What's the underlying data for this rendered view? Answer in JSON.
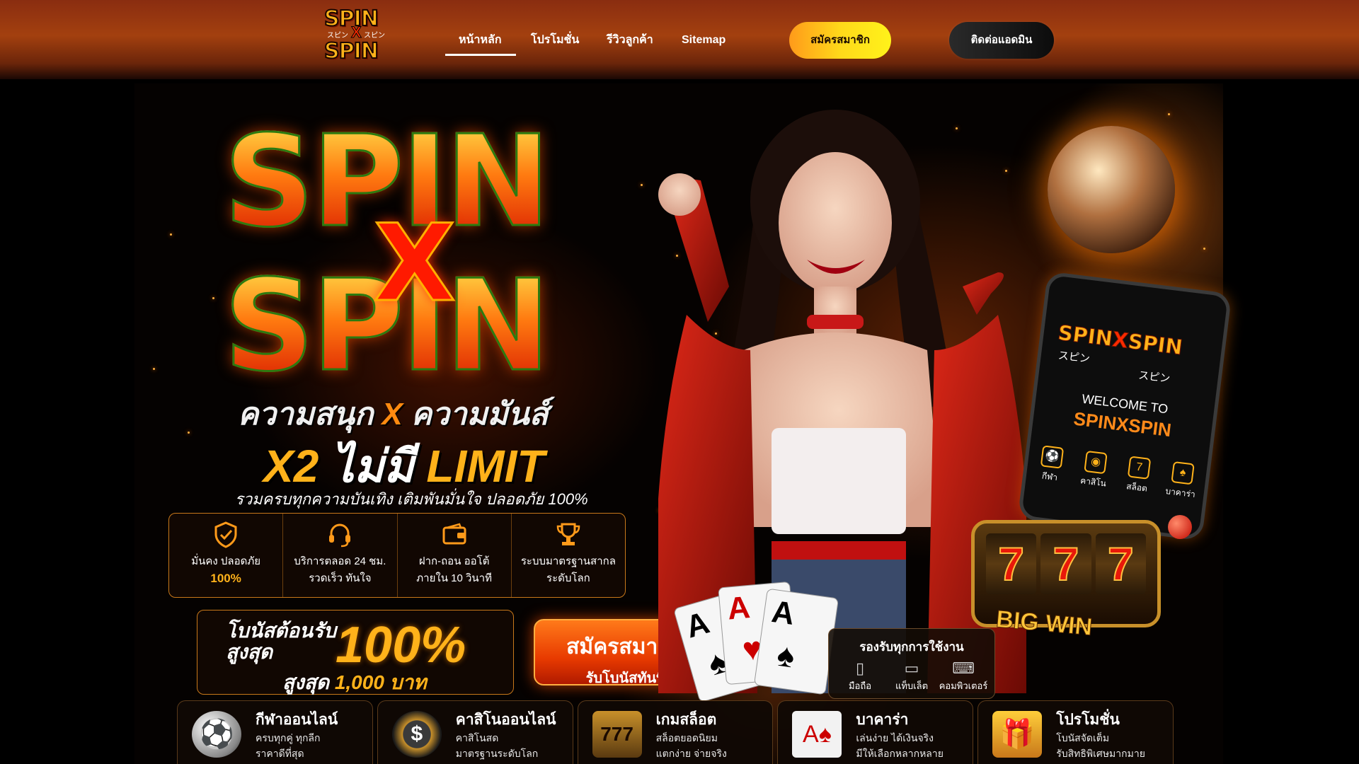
{
  "brand": {
    "logo_line1": "SPIN",
    "logo_line2": "SPIN",
    "logo_x": "X",
    "logo_kana": "スピン"
  },
  "nav": {
    "items": [
      {
        "label": "หน้าหลัก",
        "active": true
      },
      {
        "label": "โปรโมชั่น",
        "active": false
      },
      {
        "label": "รีวิวลูกค้า",
        "active": false
      },
      {
        "label": "Sitemap",
        "active": false
      }
    ],
    "register_label": "สมัครสมาชิก",
    "contact_label": "ติดต่อแอดมิน"
  },
  "hero": {
    "title_word": "SPIN",
    "title_x": "X",
    "tagline1_a": "ความสนุก",
    "tagline1_x": "X",
    "tagline1_b": "ความมันส์",
    "tagline2_a": "X2",
    "tagline2_b": "ไม่มี",
    "tagline2_c": "LIMIT",
    "tagline3": "รวมครบทุกความบันเทิง เติมพันมั่นใจ ปลอดภัย 100%",
    "features": [
      {
        "icon": "shield-check-icon",
        "line1": "มั่นคง ปลอดภัย",
        "line2": "100%",
        "highlight": true
      },
      {
        "icon": "headset-icon",
        "line1": "บริการตลอด 24 ชม.",
        "line2": "รวดเร็ว ทันใจ",
        "highlight": false
      },
      {
        "icon": "wallet-icon",
        "line1": "ฝาก-ถอน ออโต้",
        "line2": "ภายใน 10 วินาที",
        "highlight": false
      },
      {
        "icon": "trophy-icon",
        "line1": "ระบบมาตรฐานสากล",
        "line2": "ระดับโลก",
        "highlight": false
      }
    ],
    "bonus": {
      "line1": "โบนัสต้อนรับ สูงสุด",
      "percent": "100%",
      "line3_prefix": "สูงสุด",
      "amount": "1,000 บาท"
    },
    "cta": {
      "label": "สมัครสมาชิก",
      "sub": "รับโบนัสทันที"
    },
    "phone": {
      "brand_a": "SPIN",
      "brand_x": "X",
      "brand_b": "SPIN",
      "kana": "スピン",
      "welcome": "WELCOME TO",
      "name": "SPINXSPIN",
      "icons": [
        {
          "icon": "soccer-icon",
          "label": "กีฬา"
        },
        {
          "icon": "chip-icon",
          "label": "คาสิโน"
        },
        {
          "icon": "slot-icon",
          "label": "สล็อต"
        },
        {
          "icon": "cards-icon",
          "label": "บาคาร่า"
        }
      ]
    },
    "slot_reels": [
      "7",
      "7",
      "7"
    ],
    "big_win": "BIG WIN",
    "devices": {
      "title": "รองรับทุกการใช้งาน",
      "items": [
        {
          "icon": "mobile-icon",
          "label": "มือถือ"
        },
        {
          "icon": "tablet-icon",
          "label": "แท็บเล็ต"
        },
        {
          "icon": "laptop-icon",
          "label": "คอมพิวเตอร์"
        }
      ]
    }
  },
  "categories": [
    {
      "icon": "soccer-ball-icon",
      "title": "กีฬาออนไลน์",
      "line1": "ครบทุกคู่ ทุกลีก",
      "line2": "ราคาดีที่สุด"
    },
    {
      "icon": "casino-chip-icon",
      "title": "คาสิโนออนไลน์",
      "line1": "คาสิโนสด",
      "line2": "มาตรฐานระดับโลก"
    },
    {
      "icon": "slot-777-icon",
      "title": "เกมสล็อต",
      "line1": "สล็อตยอดนิยม",
      "line2": "แตกง่าย จ่ายจริง"
    },
    {
      "icon": "playing-cards-icon",
      "title": "บาคาร่า",
      "line1": "เล่นง่าย ได้เงินจริง",
      "line2": "มีให้เลือกหลากหลาย"
    },
    {
      "icon": "gift-box-icon",
      "title": "โปรโมชั่น",
      "line1": "โบนัสจัดเต็ม",
      "line2": "รับสิทธิพิเศษมากมาย"
    }
  ]
}
